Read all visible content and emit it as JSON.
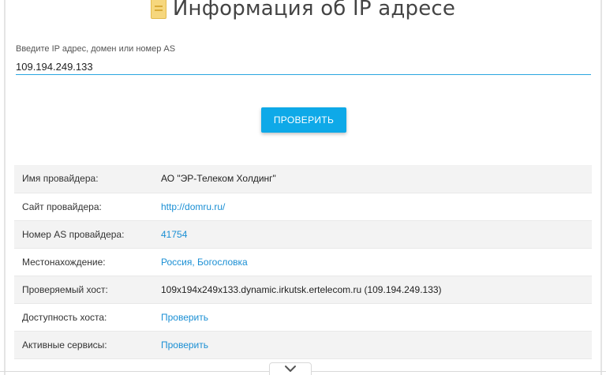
{
  "header": {
    "title": "Информация об IP адресе",
    "icon": "document-icon"
  },
  "search": {
    "label": "Введите IP адрес, домен или номер AS",
    "value": "109.194.249.133",
    "button_label": "ПРОВЕРИТЬ"
  },
  "info": {
    "rows": [
      {
        "key": "Имя провайдера:",
        "value": "АО \"ЭР-Телеком Холдинг\"",
        "is_link": false
      },
      {
        "key": "Сайт провайдера:",
        "value": "http://domru.ru/",
        "is_link": true
      },
      {
        "key": "Номер AS провайдера:",
        "value": "41754",
        "is_link": true
      },
      {
        "key": "Местонахождение:",
        "value": "Россия, Богословка",
        "is_link": true
      },
      {
        "key": "Проверяемый хост:",
        "value": "109x194x249x133.dynamic.irkutsk.ertelecom.ru (109.194.249.133)",
        "is_link": false
      },
      {
        "key": "Доступность хоста:",
        "value": "Проверить",
        "is_link": true
      },
      {
        "key": "Активные сервисы:",
        "value": "Проверить",
        "is_link": true
      }
    ]
  },
  "colors": {
    "accent": "#0ea9e8",
    "link": "#1a8fd4",
    "row_alt": "#f3f3f3"
  },
  "scroll": {
    "icon": "chevron-down-icon"
  }
}
